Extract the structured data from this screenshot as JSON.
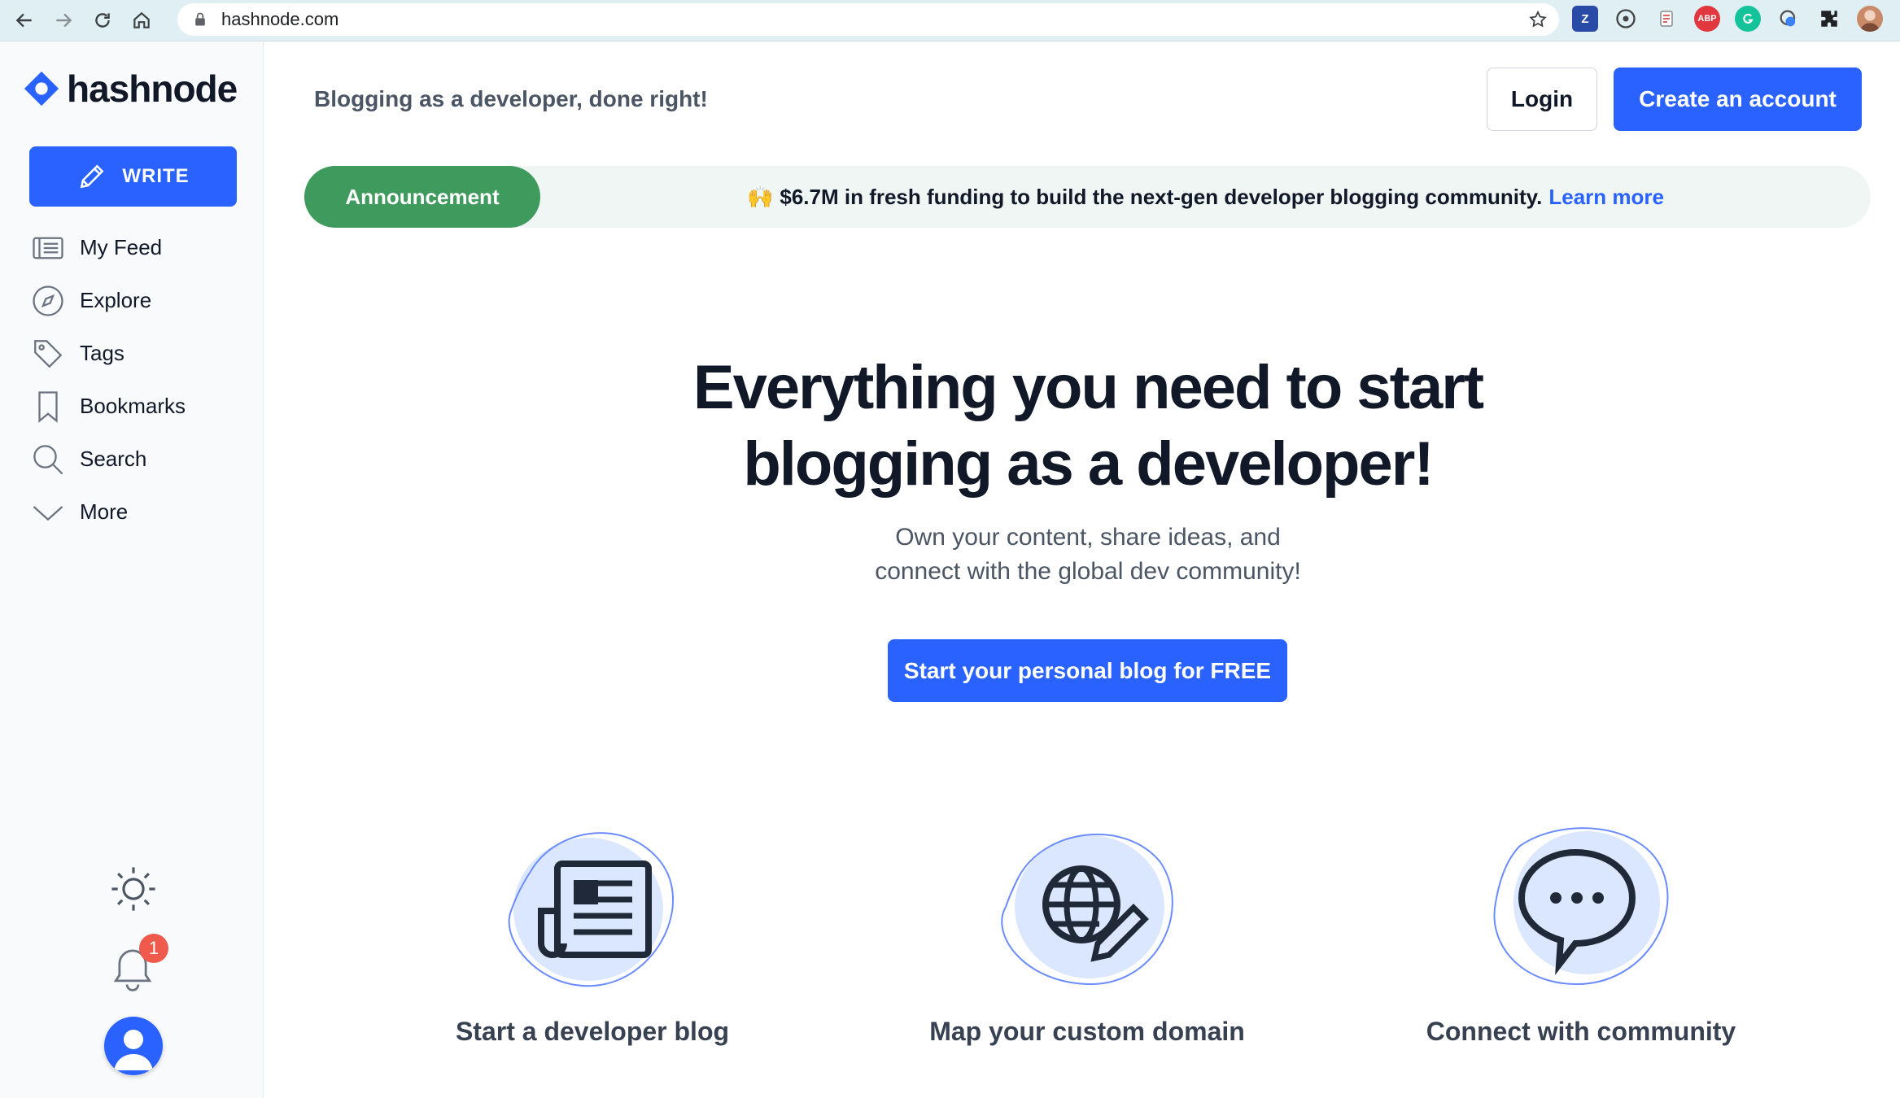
{
  "browser": {
    "url": "hashnode.com",
    "extensions": [
      "Z",
      "ABP"
    ]
  },
  "sidebar": {
    "logo_text": "hashnode",
    "write_label": "WRITE",
    "items": [
      {
        "label": "My Feed",
        "icon": "feed-icon"
      },
      {
        "label": "Explore",
        "icon": "compass-icon"
      },
      {
        "label": "Tags",
        "icon": "tag-icon"
      },
      {
        "label": "Bookmarks",
        "icon": "bookmark-icon"
      },
      {
        "label": "Search",
        "icon": "search-icon"
      },
      {
        "label": "More",
        "icon": "chevron-down-icon"
      }
    ],
    "notification_count": "1"
  },
  "header": {
    "tagline": "Blogging as a developer, done right!",
    "login_label": "Login",
    "signup_label": "Create an account"
  },
  "announcement": {
    "pill": "Announcement",
    "emoji": "🙌",
    "text": "$6.7M in fresh funding to build the next-gen developer blogging community.",
    "link": "Learn more"
  },
  "hero": {
    "title_line1": "Everything you need to start",
    "title_line2": "blogging as a developer!",
    "sub_line1": "Own your content, share ideas, and",
    "sub_line2": "connect with the global dev community!",
    "cta": "Start your personal blog for FREE"
  },
  "features": [
    {
      "label": "Start a developer blog",
      "icon": "newspaper-icon"
    },
    {
      "label": "Map your custom domain",
      "icon": "globe-pencil-icon"
    },
    {
      "label": "Connect with community",
      "icon": "chat-bubble-icon"
    }
  ],
  "colors": {
    "brand": "#2962ff",
    "announcement_green": "#3e9a5d",
    "badge_red": "#ef5a4c"
  }
}
